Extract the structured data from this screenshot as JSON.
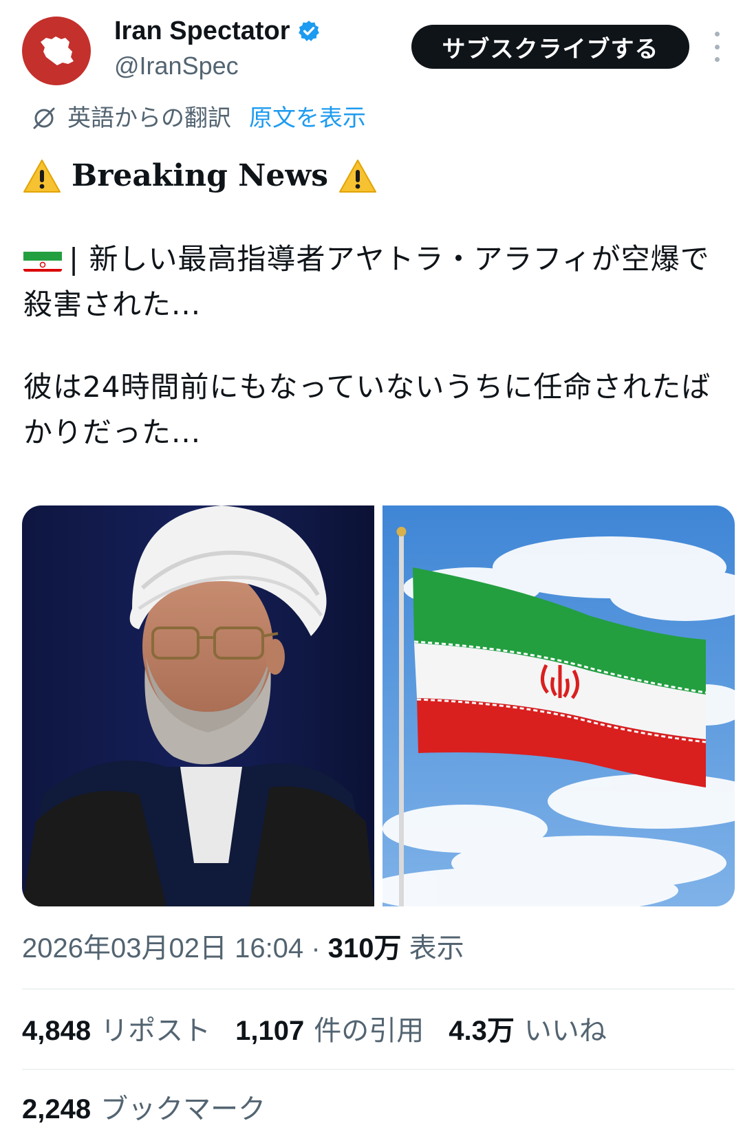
{
  "author": {
    "display_name": "Iran Spectator",
    "handle": "@IranSpec",
    "verified": true,
    "avatar_icon": "iran-map-icon",
    "avatar_color": "#c4302c"
  },
  "header": {
    "subscribe_label": "サブスクライブする",
    "more_icon": "more-vertical-icon"
  },
  "translation": {
    "label": "英語からの翻訳",
    "show_original": "原文を表示"
  },
  "tweet": {
    "headline": "Breaking News",
    "paragraph1": "| 新しい最高指導者アヤトラ・アラフィが空爆で殺害された...",
    "paragraph2": "彼は24時間前にもなっていないうちに任命されたばかりだった...",
    "media": [
      {
        "name": "photo-cleric"
      },
      {
        "name": "photo-iran-flag"
      }
    ]
  },
  "meta": {
    "timestamp": "2026年03月02日 16:04",
    "separator": "·",
    "views_count": "310万",
    "views_label": "表示"
  },
  "stats": {
    "reposts_count": "4,848",
    "reposts_label": "リポスト",
    "quotes_count": "1,107",
    "quotes_label": "件の引用",
    "likes_count": "4.3万",
    "likes_label": "いいね",
    "bookmarks_count": "2,248",
    "bookmarks_label": "ブックマーク"
  },
  "colors": {
    "link_blue": "#1d9bf0",
    "text_primary": "#0f1419",
    "text_secondary": "#536471",
    "button_bg": "#0f1419"
  }
}
